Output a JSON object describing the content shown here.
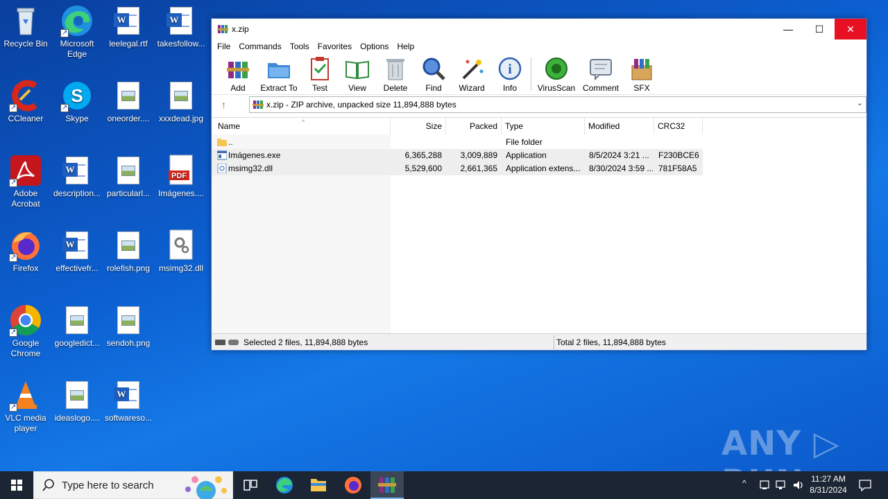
{
  "desktop": {
    "icons": [
      {
        "label": "Recycle Bin"
      },
      {
        "label": "Microsoft Edge"
      },
      {
        "label": "leelegal.rtf"
      },
      {
        "label": "takesfollow..."
      },
      {
        "label": "CCleaner"
      },
      {
        "label": "Skype"
      },
      {
        "label": "oneorder...."
      },
      {
        "label": "xxxdead.jpg"
      },
      {
        "label": "Adobe Acrobat"
      },
      {
        "label": "description..."
      },
      {
        "label": "particularl..."
      },
      {
        "label": "Imágenes...."
      },
      {
        "label": "Firefox"
      },
      {
        "label": "effectivefr..."
      },
      {
        "label": "rolefish.png"
      },
      {
        "label": "msimg32.dll"
      },
      {
        "label": "Google Chrome"
      },
      {
        "label": "googledict..."
      },
      {
        "label": "sendoh.png"
      },
      {
        "label": "VLC media player"
      },
      {
        "label": "ideaslogo...."
      },
      {
        "label": "softwareso..."
      }
    ]
  },
  "window": {
    "title": "x.zip",
    "controls": {
      "minimize": "—",
      "maximize": "☐",
      "close": "✕"
    },
    "menu": [
      "File",
      "Commands",
      "Tools",
      "Favorites",
      "Options",
      "Help"
    ],
    "toolbar": [
      "Add",
      "Extract To",
      "Test",
      "View",
      "Delete",
      "Find",
      "Wizard",
      "Info",
      "VirusScan",
      "Comment",
      "SFX"
    ],
    "address": "x.zip - ZIP archive, unpacked size 11,894,888 bytes",
    "columns": [
      "Name",
      "Size",
      "Packed",
      "Type",
      "Modified",
      "CRC32"
    ],
    "rows": [
      {
        "name": "..",
        "size": "",
        "packed": "",
        "type": "File folder",
        "modified": "",
        "crc": ""
      },
      {
        "name": "Imágenes.exe",
        "size": "6,365,288",
        "packed": "3,009,889",
        "type": "Application",
        "modified": "8/5/2024 3:21 ...",
        "crc": "F230BCE6"
      },
      {
        "name": "msimg32.dll",
        "size": "5,529,600",
        "packed": "2,661,365",
        "type": "Application extens...",
        "modified": "8/30/2024 3:59 ...",
        "crc": "781F58A5"
      }
    ],
    "status_left": "Selected 2 files, 11,894,888 bytes",
    "status_right": "Total 2 files, 11,894,888 bytes"
  },
  "watermark": "ANY ▷ RUN",
  "taskbar": {
    "search_placeholder": "Type here to search",
    "time": "11:27 AM",
    "date": "8/31/2024"
  }
}
